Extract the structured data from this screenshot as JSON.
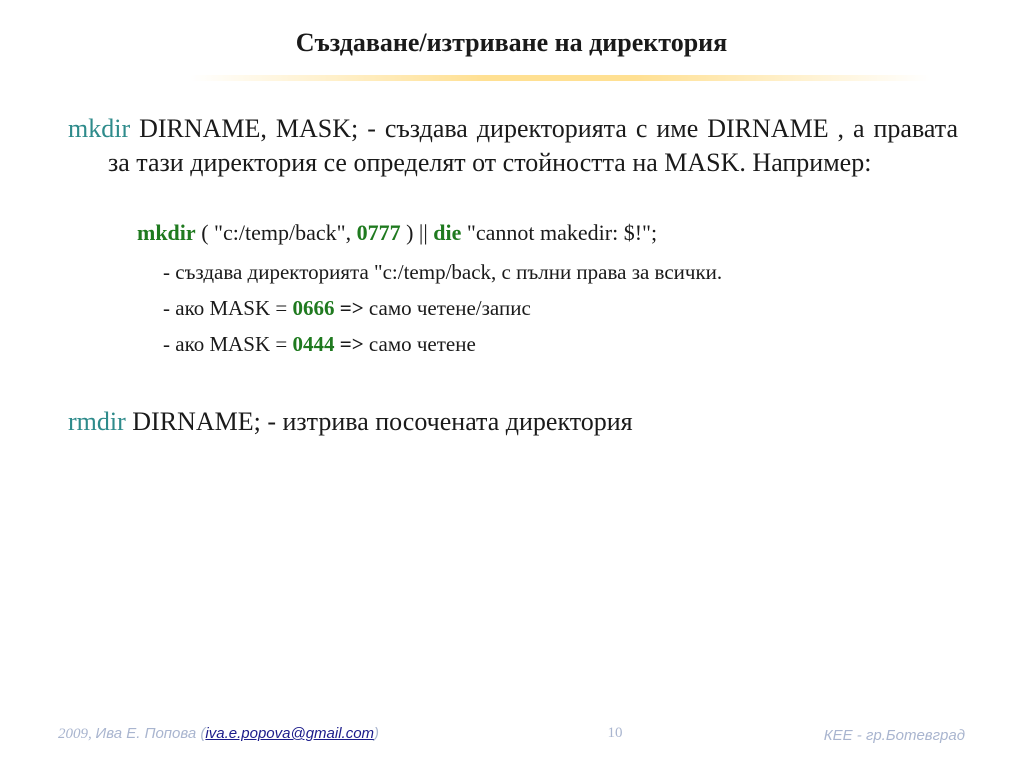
{
  "title": "Създаване/изтриване на директория",
  "mkdir": {
    "keyword": "mkdir",
    "text": " DIRNAME, MASK;  - създава директорията с име DIRNAME , а правата за тази директория се определят от стойността на MASK. Например:"
  },
  "example": {
    "kw1": "mkdir",
    "part1": " ( \"c:/temp/back\", ",
    "num": "0777",
    "part2": " ) || ",
    "kw2": "die",
    "part3": " \"cannot makedir: $!\";"
  },
  "notes": [
    {
      "text": "- създава директорията \"c:/temp/back,  с пълни права за всички."
    },
    {
      "prefix": "- ако MASK = ",
      "num": "0666",
      "arrow": " =>",
      "suffix": " само четене/запис"
    },
    {
      "prefix": "- ако MASK = ",
      "num": "0444",
      "arrow": " =>",
      "suffix": " само четене"
    }
  ],
  "rmdir": {
    "keyword": "rmdir",
    "text": " DIRNAME; - изтрива посочената директория"
  },
  "footer": {
    "year": "2009, ",
    "author": "Ива Е. Попова  (",
    "email": "iva.e.popova@gmail.com",
    "close": ")",
    "page": "10",
    "org": "КЕЕ - гр.Ботевград"
  }
}
